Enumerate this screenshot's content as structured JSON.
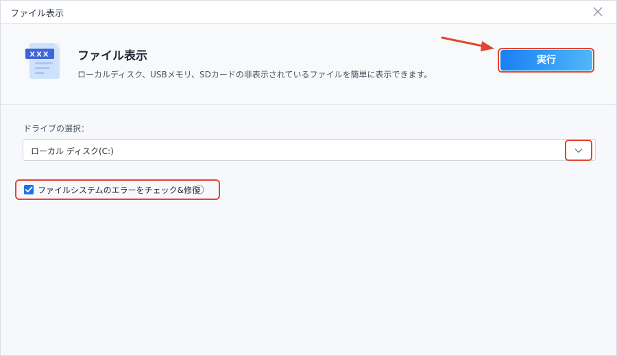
{
  "window": {
    "title": "ファイル表示"
  },
  "header": {
    "title": "ファイル表示",
    "description": "ローカルディスク、USBメモリ、SDカードの非表示されているファイルを簡単に表示できます。",
    "icon_text": "XXX",
    "run_label": "実行"
  },
  "drive": {
    "label": "ドライブの選択：",
    "selected": "ローカル ディスク(C:)"
  },
  "options": {
    "check_fs_label": "ファイルシステムのエラーをチェック&修復",
    "check_fs_checked": true
  },
  "colors": {
    "accent": "#1a73e8",
    "highlight": "#e2452c"
  }
}
